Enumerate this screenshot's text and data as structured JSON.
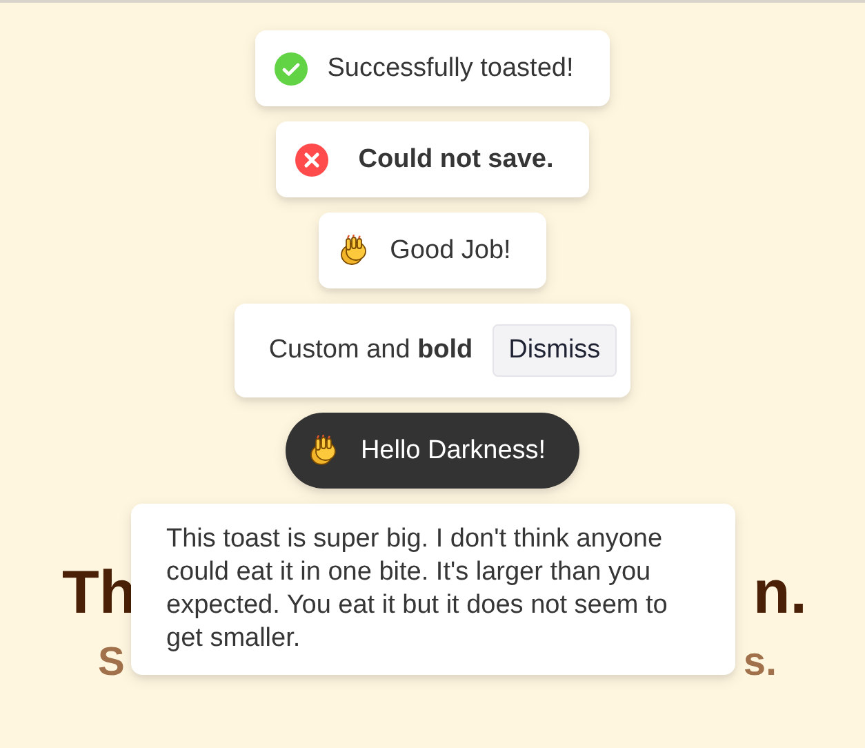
{
  "toasts": [
    {
      "kind": "success",
      "message": "Successfully toasted!"
    },
    {
      "kind": "error",
      "message": "Could not save."
    },
    {
      "kind": "emoji",
      "message": "Good Job!"
    },
    {
      "kind": "custom",
      "message": "Custom and **bold**",
      "button": "Dismiss"
    },
    {
      "kind": "dark",
      "message": "Hello Darkness!"
    },
    {
      "kind": "plain",
      "message": "This toast is super big. I don't think anyone could eat it in one bite. It's larger than you expected. You eat it but it does not seem to get smaller."
    }
  ],
  "hero": {
    "title_start": "Th",
    "title_end": "n.",
    "subtitle_start": "S",
    "subtitle_end": "s."
  }
}
